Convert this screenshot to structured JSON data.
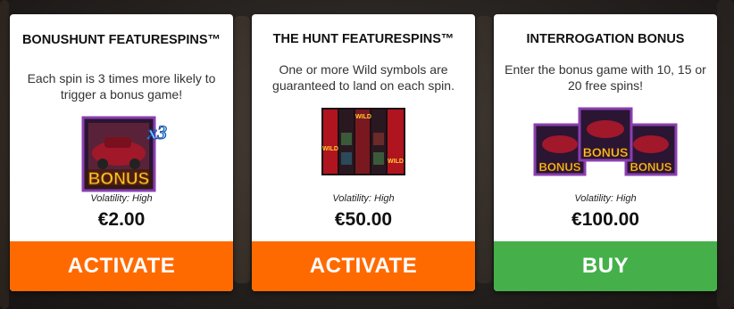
{
  "cards": [
    {
      "title": "BONUSHUNT FEATURESPINS™",
      "description": "Each spin is 3 times more likely to trigger a bonus game!",
      "art": {
        "badge": "BONUS",
        "multiplier": "x3"
      },
      "volatility": "Volatility: High",
      "price": "€2.00",
      "button": "ACTIVATE",
      "button_color": "#ff6a00"
    },
    {
      "title": "THE HUNT FEATURESPINS™",
      "description": "One or more Wild symbols are guaranteed to land on each spin.",
      "art": {
        "symbols": [
          "WILD",
          "WILD",
          "WILD"
        ]
      },
      "volatility": "Volatility: High",
      "price": "€50.00",
      "button": "ACTIVATE",
      "button_color": "#ff6a00"
    },
    {
      "title": "INTERROGATION BONUS",
      "description": "Enter the bonus game with 10, 15 or 20 free spins!",
      "art": {
        "badges": [
          "BONUS",
          "BONUS",
          "BONUS"
        ]
      },
      "volatility": "Volatility: High",
      "price": "€100.00",
      "button": "BUY",
      "button_color": "#45b04a"
    }
  ]
}
